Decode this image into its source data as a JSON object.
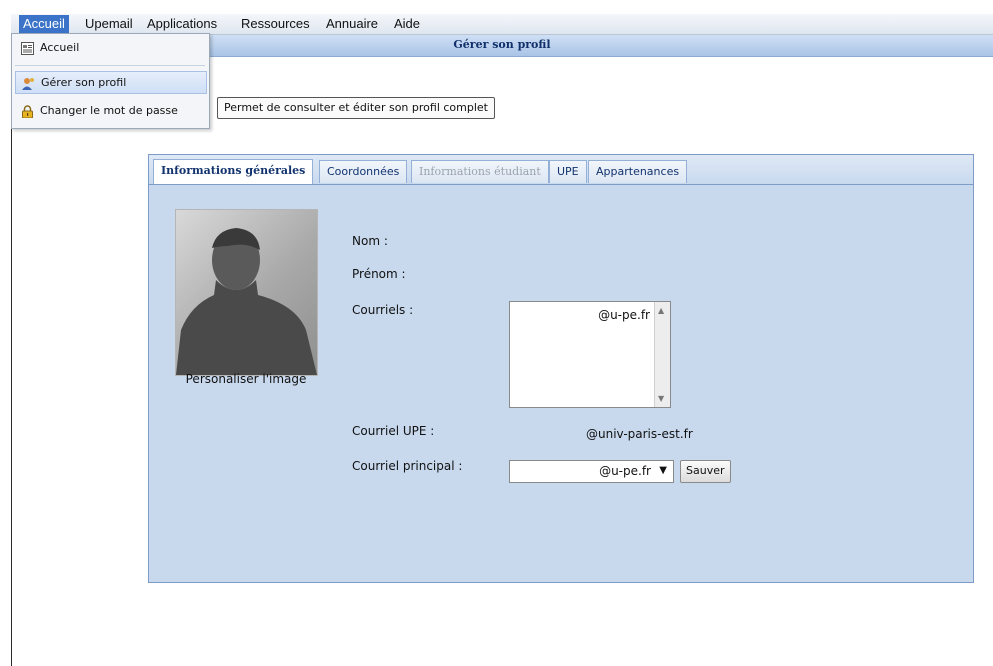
{
  "menubar": {
    "items": [
      {
        "label": "Accueil"
      },
      {
        "label": "Upemail"
      },
      {
        "label": "Applications"
      },
      {
        "label": "Ressources"
      },
      {
        "label": "Annuaire"
      },
      {
        "label": "Aide"
      }
    ]
  },
  "window": {
    "title": "Gérer son profil"
  },
  "dropdown": {
    "items": [
      {
        "label": "Accueil",
        "icon": "document-icon"
      },
      {
        "label": "Gérer son profil",
        "icon": "user-icon"
      },
      {
        "label": "Changer le mot de passe",
        "icon": "lock-icon"
      }
    ]
  },
  "tooltip": {
    "text": "Permet de consulter et éditer son profil complet"
  },
  "tabs": [
    {
      "label": "Informations générales"
    },
    {
      "label": "Coordonnées"
    },
    {
      "label": "Informations étudiant"
    },
    {
      "label": "UPE"
    },
    {
      "label": "Appartenances"
    }
  ],
  "profile": {
    "photo_caption": "Personaliser l'image",
    "nom_label": "Nom :",
    "prenom_label": "Prénom :",
    "courriels_label": "Courriels :",
    "courriels_value": "@u-pe.fr",
    "courriel_upe_label": "Courriel UPE :",
    "courriel_upe_value": "@univ-paris-est.fr",
    "courriel_principal_label": "Courriel principal :",
    "courriel_principal_value": "@u-pe.fr",
    "save_label": "Sauver"
  },
  "colors": {
    "menu_active": "#3a73c7",
    "panel_bg": "#c8d9ee",
    "title_text": "#11306a"
  }
}
